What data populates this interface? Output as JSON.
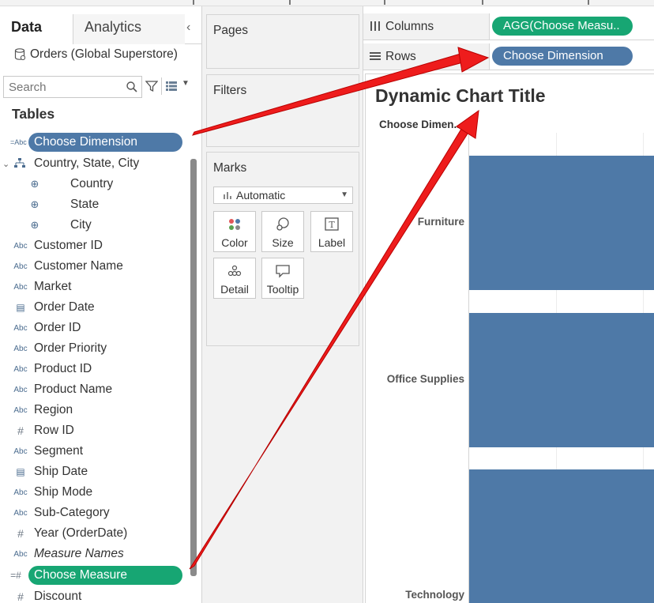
{
  "left_pane": {
    "tabs": [
      {
        "label": "Data",
        "active": true
      },
      {
        "label": "Analytics",
        "active": false
      }
    ],
    "data_source": "Orders (Global Superstore)",
    "search": {
      "placeholder": "Search",
      "value": ""
    },
    "tables_header": "Tables",
    "fields": [
      {
        "label": "Choose Dimension",
        "type": "string-parameter",
        "highlight": "blue"
      },
      {
        "label": "Country, State, City",
        "type": "hierarchy",
        "expanded": true
      },
      {
        "label": "Country",
        "type": "geo",
        "indent": true
      },
      {
        "label": "State",
        "type": "geo",
        "indent": true
      },
      {
        "label": "City",
        "type": "geo",
        "indent": true
      },
      {
        "label": "Customer ID",
        "type": "string"
      },
      {
        "label": "Customer Name",
        "type": "string"
      },
      {
        "label": "Market",
        "type": "string"
      },
      {
        "label": "Order Date",
        "type": "date"
      },
      {
        "label": "Order ID",
        "type": "string"
      },
      {
        "label": "Order Priority",
        "type": "string"
      },
      {
        "label": "Product ID",
        "type": "string"
      },
      {
        "label": "Product Name",
        "type": "string"
      },
      {
        "label": "Region",
        "type": "string"
      },
      {
        "label": "Row ID",
        "type": "number"
      },
      {
        "label": "Segment",
        "type": "string"
      },
      {
        "label": "Ship Date",
        "type": "date"
      },
      {
        "label": "Ship Mode",
        "type": "string"
      },
      {
        "label": "Sub-Category",
        "type": "string"
      },
      {
        "label": "Year (OrderDate)",
        "type": "number"
      },
      {
        "label": "Measure Names",
        "type": "string",
        "italic": true
      },
      {
        "label": "Choose Measure",
        "type": "number-parameter",
        "highlight": "green"
      },
      {
        "label": "Discount",
        "type": "number"
      }
    ]
  },
  "cards": {
    "pages": "Pages",
    "filters": "Filters",
    "marks": {
      "title": "Marks",
      "mark_type": "Automatic",
      "buttons": [
        "Color",
        "Size",
        "Label",
        "Detail",
        "Tooltip"
      ]
    }
  },
  "shelves": {
    "columns": {
      "label": "Columns",
      "pill": "AGG(Choose Measu.."
    },
    "rows": {
      "label": "Rows",
      "pill": "Choose Dimension"
    }
  },
  "view": {
    "title": "Dynamic Chart Title",
    "row_header": "Choose Dimen..",
    "categories": [
      "Furniture",
      "Office Supplies",
      "Technology"
    ]
  },
  "chart_data": {
    "type": "bar",
    "title": "Dynamic Chart Title",
    "categories": [
      "Furniture",
      "Office Supplies",
      "Technology"
    ],
    "orientation": "horizontal",
    "note_values_clipped": true,
    "ylabel": "Choose Dimen.."
  },
  "colors": {
    "bar": "#4e79a7",
    "dimension_pill": "#4e79a7",
    "measure_pill": "#17a673",
    "annotation_arrow": "#ee1c1c"
  },
  "icons": {
    "datasource": "database-icon",
    "search": "search-icon",
    "filter": "filter-icon",
    "view_toggle": "list-view-icon",
    "string_field": "abc-icon",
    "number_field": "hash-icon",
    "date_field": "calendar-icon",
    "geo_field": "globe-icon",
    "hierarchy": "hierarchy-icon"
  }
}
